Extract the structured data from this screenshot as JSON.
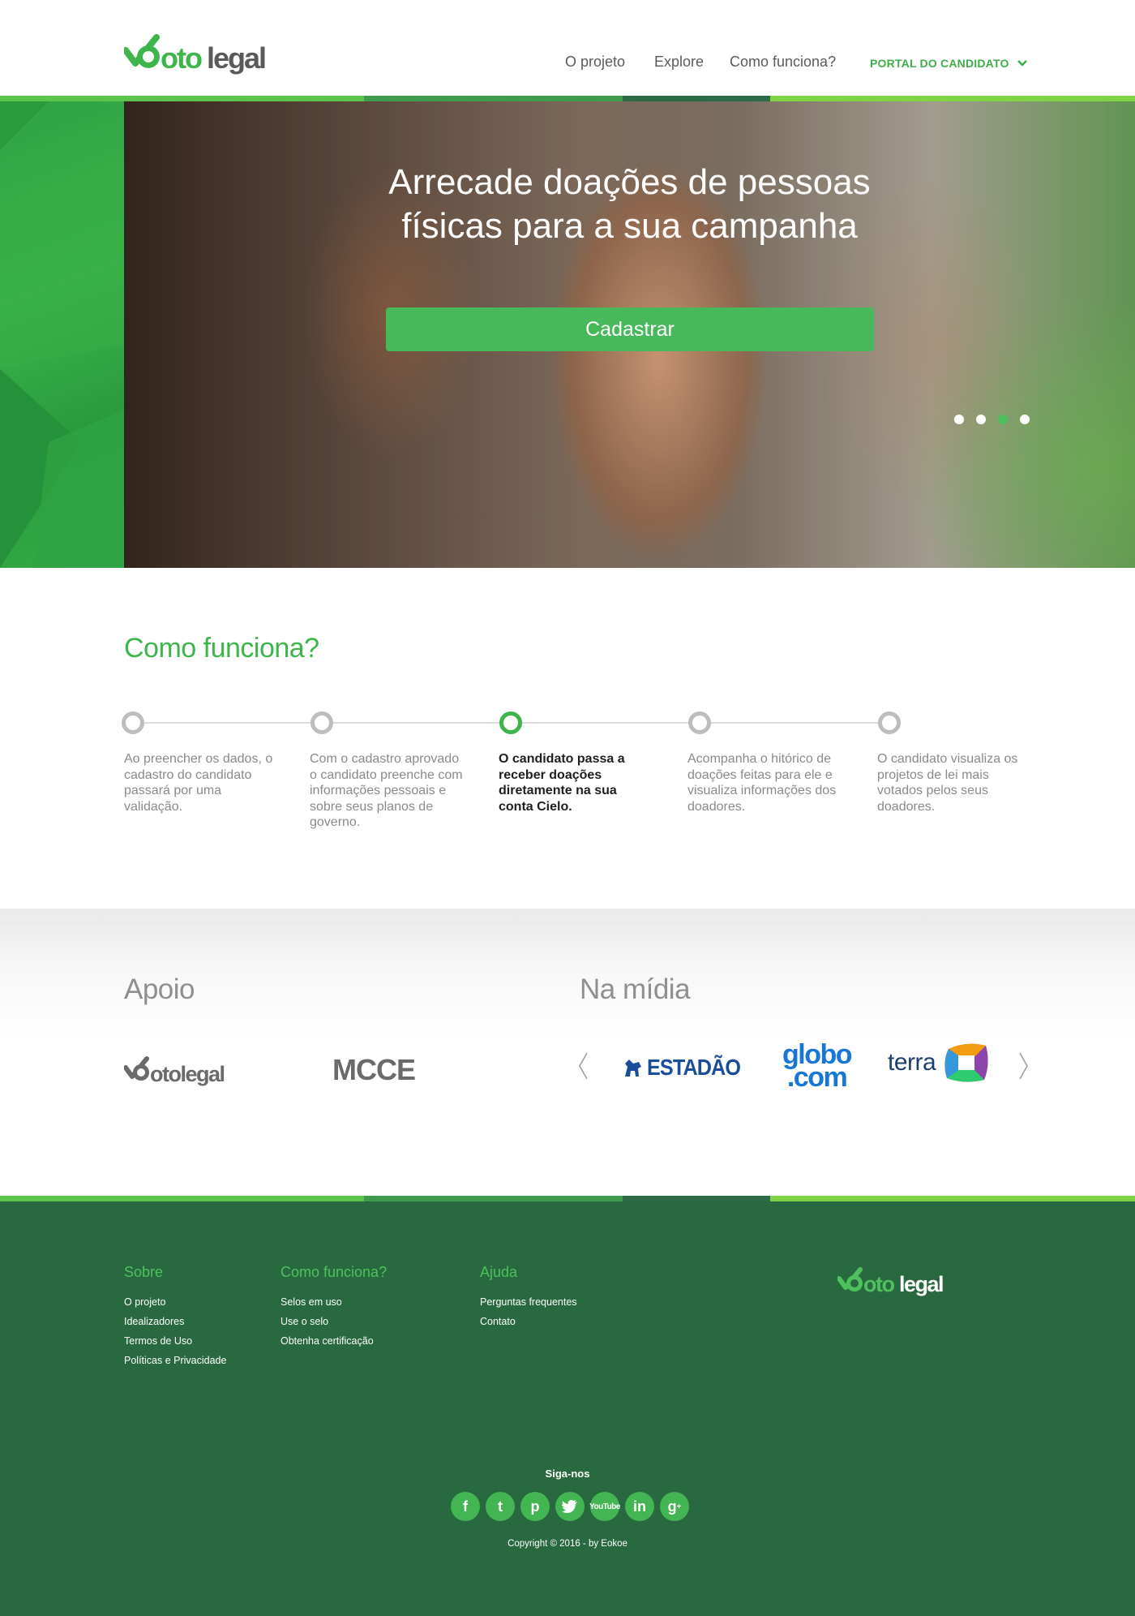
{
  "header": {
    "logo_text": "Votolegal",
    "nav": [
      "O projeto",
      "Explore",
      "Como funciona?"
    ],
    "portal_label": "PORTAL DO CANDIDATO"
  },
  "hero": {
    "title_line1": "Arrecade doações de pessoas",
    "title_line2": "físicas para a sua campanha",
    "button_label": "Cadastrar",
    "slides_count": 4,
    "active_slide": 3
  },
  "how": {
    "title": "Como funciona?",
    "active_step": 3,
    "steps": [
      "Ao preencher os dados, o cadastro do candidato passará por uma validação.",
      "Com o cadastro aprovado o candidato preenche com informações pessoais e sobre seus planos de governo.",
      "O candidato passa a receber doações diretamente na sua conta Cielo.",
      "Acompanha o hitórico de doações feitas para ele e visualiza informações dos doadores.",
      "O candidato visualiza os projetos de lei mais votados pelos seus doadores."
    ]
  },
  "partners": {
    "apoio_title": "Apoio",
    "apoio_logos": [
      "Votolegal",
      "MCCE"
    ],
    "midia_title": "Na mídia",
    "midia_logos": [
      "ESTADÃO",
      "globo",
      "com",
      "terra"
    ]
  },
  "footer": {
    "columns": [
      {
        "title": "Sobre",
        "links": [
          "O projeto",
          "Idealizadores",
          "Termos de Uso",
          "Políticas e Privacidade"
        ]
      },
      {
        "title": "Como funciona?",
        "links": [
          "Selos em uso",
          "Use o selo",
          "Obtenha certificação"
        ]
      },
      {
        "title": "Ajuda",
        "links": [
          "Perguntas frequentes",
          "Contato"
        ]
      }
    ],
    "follow_label": "Siga-nos",
    "socials": [
      "f",
      "t",
      "p",
      "twitter",
      "You Tube",
      "in",
      "g+"
    ],
    "copyright": "Copyright © 2016 - by Eokoe"
  },
  "colors": {
    "brand_green": "#3db54b",
    "footer_green": "#29693f",
    "text_gray": "#8a8a8a"
  }
}
